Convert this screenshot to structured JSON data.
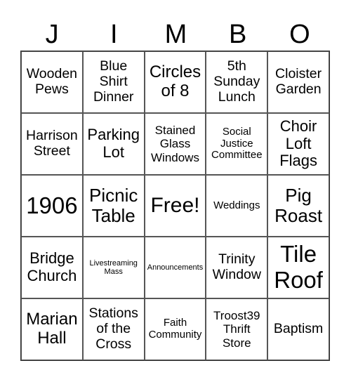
{
  "card": {
    "header": [
      "J",
      "I",
      "M",
      "B",
      "O"
    ],
    "cells": [
      {
        "text": "Wooden Pews",
        "size": "s19"
      },
      {
        "text": "Blue Shirt Dinner",
        "size": "s19"
      },
      {
        "text": "Circles of 8",
        "size": "s24"
      },
      {
        "text": "5th Sunday Lunch",
        "size": "s19"
      },
      {
        "text": "Cloister Garden",
        "size": "s19"
      },
      {
        "text": "Harrison Street",
        "size": "s19"
      },
      {
        "text": "Parking Lot",
        "size": "s22"
      },
      {
        "text": "Stained Glass Windows",
        "size": "s16"
      },
      {
        "text": "Social Justice Committee",
        "size": "s12"
      },
      {
        "text": "Choir Loft Flags",
        "size": "s22"
      },
      {
        "text": "1906",
        "size": "s32"
      },
      {
        "text": "Picnic Table",
        "size": "s26"
      },
      {
        "text": "Free!",
        "size": "s30"
      },
      {
        "text": "Weddings",
        "size": "s12"
      },
      {
        "text": "Pig Roast",
        "size": "s26"
      },
      {
        "text": "Bridge Church",
        "size": "s22"
      },
      {
        "text": "Livestreaming Mass",
        "size": "s9"
      },
      {
        "text": "Announcements",
        "size": "s9"
      },
      {
        "text": "Trinity Window",
        "size": "s19"
      },
      {
        "text": "Tile Roof",
        "size": "s32"
      },
      {
        "text": "Marian Hall",
        "size": "s24"
      },
      {
        "text": "Stations of the Cross",
        "size": "s19"
      },
      {
        "text": "Faith Community",
        "size": "s12"
      },
      {
        "text": "Troost39 Thrift Store",
        "size": "s16"
      },
      {
        "text": "Baptism",
        "size": "s19"
      }
    ]
  }
}
